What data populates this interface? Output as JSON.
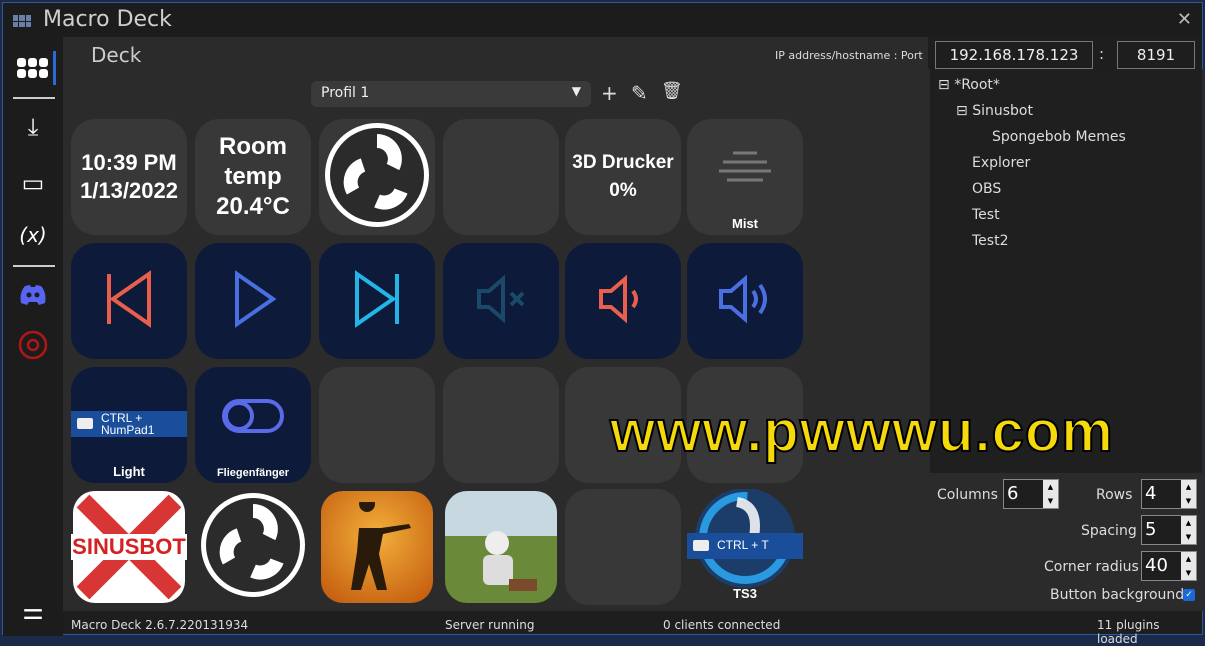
{
  "window": {
    "title": "Macro Deck",
    "close": "✕"
  },
  "sidebar": {
    "items": [
      {
        "icon": "deck-grid-icon"
      },
      {
        "icon": "download-icon",
        "glyph": "⤓"
      },
      {
        "icon": "devices-icon",
        "glyph": "▭"
      },
      {
        "icon": "variables-icon",
        "glyph": "(x)"
      },
      {
        "icon": "discord-icon"
      },
      {
        "icon": "obs-icon"
      },
      {
        "icon": "settings-sliders-icon",
        "glyph": "⚌"
      }
    ]
  },
  "main": {
    "title": "Deck",
    "profile": "Profil 1",
    "add": "+",
    "edit": "✎",
    "delete": "🗑"
  },
  "buttons": [
    {
      "lines": [
        "10:39 PM",
        "1/13/2022"
      ]
    },
    {
      "lines": [
        "Room",
        "temp",
        "20.4°C"
      ]
    },
    {
      "icon": "obs-icon"
    },
    {},
    {
      "lines": [
        "3D Drucker",
        "0%"
      ]
    },
    {
      "label": "Mist",
      "icon": "mist-icon"
    },
    {
      "icon": "previous-icon",
      "color": "#e8604c"
    },
    {
      "icon": "play-icon",
      "color": "#4a6fe0"
    },
    {
      "icon": "next-icon",
      "color": "#22b5e8"
    },
    {
      "icon": "mute-icon",
      "color": "#1a4a6a"
    },
    {
      "icon": "volume-low-icon",
      "color": "#e8604c"
    },
    {
      "icon": "volume-high-icon",
      "color": "#4a6fe0"
    },
    {
      "label": "Light",
      "hotkey": "CTRL +\nNumPad1"
    },
    {
      "label": "Fliegenfänger",
      "icon": "toggle-icon"
    },
    {},
    {},
    {},
    {},
    {
      "text": "SINUSBOT",
      "icon": "sinusbot-icon"
    },
    {
      "icon": "obs-icon"
    },
    {
      "icon": "counter-strike-icon"
    },
    {
      "icon": "pubg-icon"
    },
    {},
    {
      "label": "TS3",
      "hotkey": "CTRL + T",
      "icon": "teamspeak-icon"
    }
  ],
  "connection": {
    "label": "IP address/hostname : Port",
    "ip": "192.168.178.123",
    "sep": ":",
    "port": "8191"
  },
  "tree": [
    "*Root*",
    "Sinusbot",
    "Spongebob Memes",
    "Explorer",
    "OBS",
    "Test",
    "Test2"
  ],
  "settings": {
    "columns_label": "Columns",
    "columns": "6",
    "rows_label": "Rows",
    "rows": "4",
    "spacing_label": "Spacing",
    "spacing": "5",
    "radius_label": "Corner radius",
    "radius": "40",
    "bg_label": "Button background",
    "bg_checked": true
  },
  "status": {
    "version": "Macro Deck 2.6.7.220131934",
    "server": "Server running",
    "clients": "0 clients connected",
    "plugins": "11 plugins loaded"
  },
  "watermark": "www.pwwwu.com"
}
